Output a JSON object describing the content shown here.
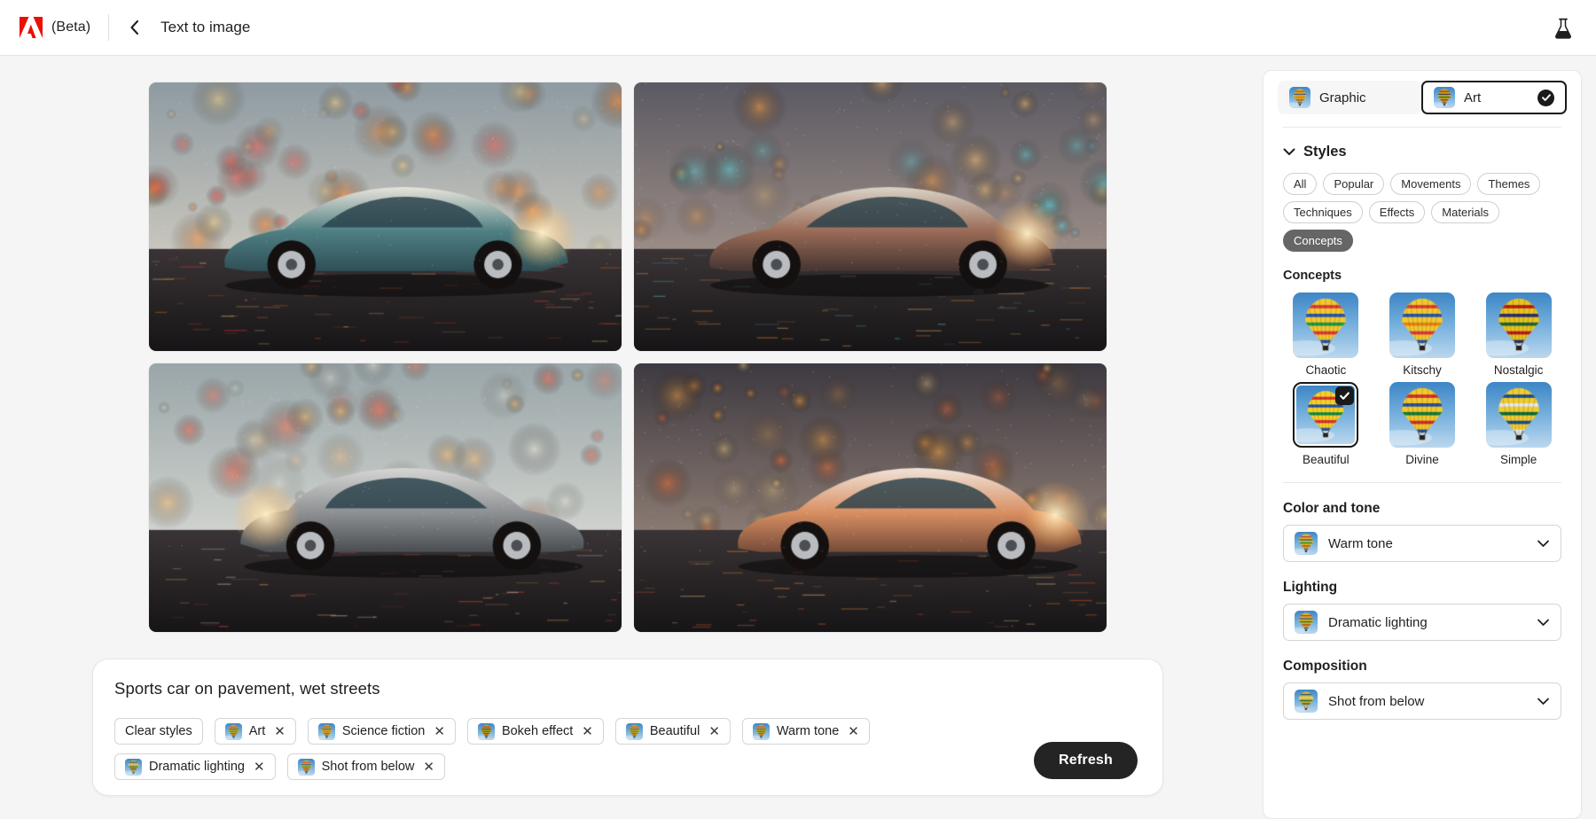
{
  "topbar": {
    "brand_icon": "adobe-logo-icon",
    "beta_label": "(Beta)",
    "back_icon": "chevron-left-icon",
    "title": "Text to image",
    "lab_icon": "beaker-icon"
  },
  "results": {
    "images": [
      {
        "alt": "Sports car on wet city street, teal and cream, neon reflections"
      },
      {
        "alt": "Sports car on rainy street, warm bokeh lights, side view"
      },
      {
        "alt": "Silver sports car rear three-quarter view on wet pavement"
      },
      {
        "alt": "White-orange sports car on rainy street with bokeh"
      }
    ]
  },
  "prompt": {
    "text": "Sports car on pavement, wet streets",
    "clear_label": "Clear styles",
    "remove_icon": "close-icon",
    "chips": [
      {
        "label": "Art"
      },
      {
        "label": "Science fiction"
      },
      {
        "label": "Bokeh effect"
      },
      {
        "label": "Beautiful"
      },
      {
        "label": "Warm tone"
      },
      {
        "label": "Dramatic lighting"
      },
      {
        "label": "Shot from below"
      }
    ],
    "refresh_label": "Refresh"
  },
  "panel": {
    "content_type": {
      "options": [
        {
          "label": "Graphic",
          "selected": false
        },
        {
          "label": "Art",
          "selected": true
        }
      ],
      "check_icon": "check-icon"
    },
    "styles": {
      "header": "Styles",
      "collapse_icon": "chevron-down-icon",
      "filters": [
        {
          "label": "All",
          "active": false
        },
        {
          "label": "Popular",
          "active": false
        },
        {
          "label": "Movements",
          "active": false
        },
        {
          "label": "Themes",
          "active": false
        },
        {
          "label": "Techniques",
          "active": false
        },
        {
          "label": "Effects",
          "active": false
        },
        {
          "label": "Materials",
          "active": false
        },
        {
          "label": "Concepts",
          "active": true
        }
      ],
      "group_title": "Concepts",
      "thumbs": [
        {
          "label": "Chaotic",
          "selected": false
        },
        {
          "label": "Kitschy",
          "selected": false
        },
        {
          "label": "Nostalgic",
          "selected": false
        },
        {
          "label": "Beautiful",
          "selected": true
        },
        {
          "label": "Divine",
          "selected": false
        },
        {
          "label": "Simple",
          "selected": false
        }
      ]
    },
    "color_and_tone": {
      "label": "Color and tone",
      "value": "Warm tone",
      "chevron": "chevron-down-icon"
    },
    "lighting": {
      "label": "Lighting",
      "value": "Dramatic lighting",
      "chevron": "chevron-down-icon"
    },
    "composition": {
      "label": "Composition",
      "value": "Shot from below",
      "chevron": "chevron-down-icon"
    }
  },
  "colors": {
    "accent": "#1a1a1a",
    "brand_red": "#eb1000",
    "canvas_bg": "#f5f5f5",
    "panel_bg": "#ffffff",
    "active_filter_bg": "#666666"
  }
}
